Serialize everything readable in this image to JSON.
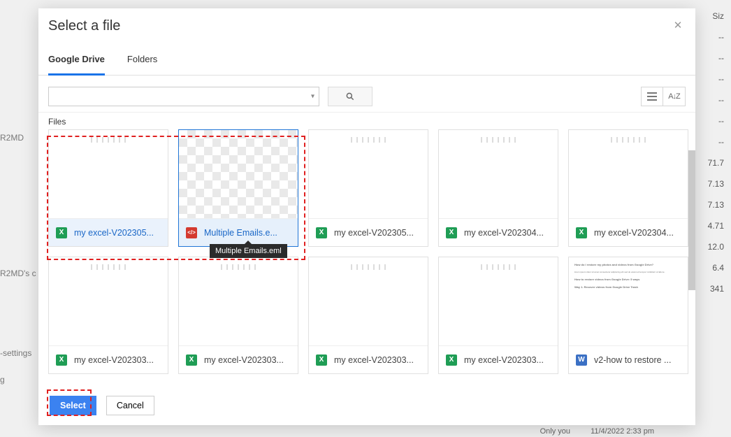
{
  "background": {
    "rows": [
      "Siz",
      "--",
      "--",
      "--",
      "--",
      "--",
      "--",
      "71.7",
      "7.13",
      "7.13",
      "4.71",
      "12.0",
      "6.4",
      "341"
    ],
    "side_text": [
      "R2MD",
      "R2MD's c",
      "-settings",
      "g"
    ],
    "bottom_time": "11/4/2022 2:33 pm",
    "bottom_owner": "Only you"
  },
  "modal": {
    "title": "Select a file",
    "tabs": {
      "drive": "Google Drive",
      "folders": "Folders"
    },
    "toolbar": {
      "search_placeholder": "",
      "files_label": "Files"
    },
    "tooltip": "Multiple Emails.eml",
    "buttons": {
      "select": "Select",
      "cancel": "Cancel"
    }
  },
  "files": [
    {
      "name": "my excel-V202305...",
      "icon": "excel",
      "thumb": "spiral",
      "state": "sel-light"
    },
    {
      "name": "Multiple Emails.e...",
      "icon": "code",
      "thumb": "checker",
      "state": "selected"
    },
    {
      "name": "my excel-V202305...",
      "icon": "excel",
      "thumb": "spiral",
      "state": ""
    },
    {
      "name": "my excel-V202304...",
      "icon": "excel",
      "thumb": "spiral",
      "state": ""
    },
    {
      "name": "my excel-V202304...",
      "icon": "excel",
      "thumb": "spiral",
      "state": ""
    },
    {
      "name": "my excel-V202303...",
      "icon": "excel",
      "thumb": "spiral",
      "state": ""
    },
    {
      "name": "my excel-V202303...",
      "icon": "excel",
      "thumb": "spiral",
      "state": ""
    },
    {
      "name": "my excel-V202303...",
      "icon": "excel",
      "thumb": "spiral",
      "state": ""
    },
    {
      "name": "my excel-V202303...",
      "icon": "excel",
      "thumb": "spiral",
      "state": ""
    },
    {
      "name": "v2-how to restore ...",
      "icon": "word",
      "thumb": "doc",
      "state": ""
    }
  ]
}
